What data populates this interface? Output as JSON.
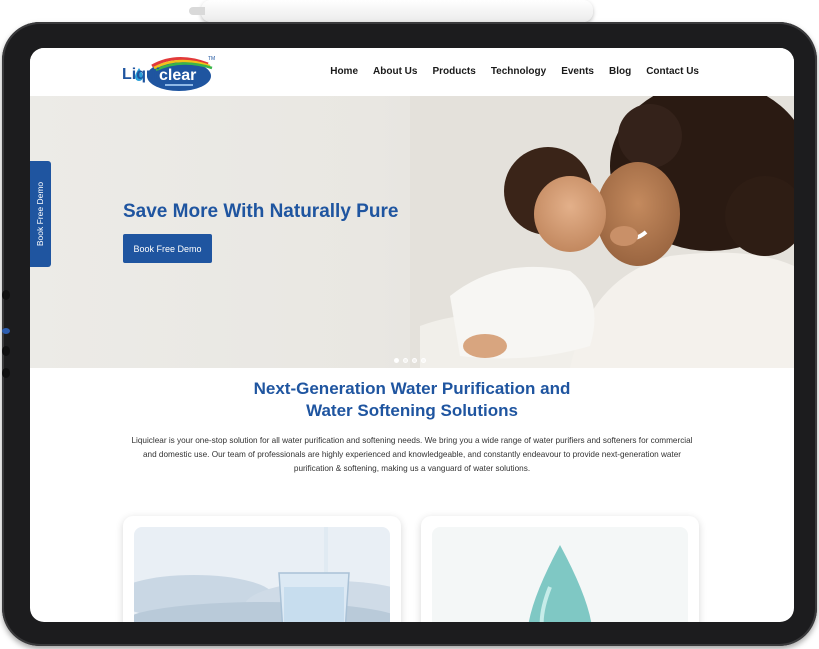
{
  "brand": {
    "name_part1": "Liqui",
    "name_part2": "clear",
    "trademark": "TM"
  },
  "nav": {
    "items": [
      {
        "label": "Home"
      },
      {
        "label": "About Us"
      },
      {
        "label": "Products"
      },
      {
        "label": "Technology"
      },
      {
        "label": "Events"
      },
      {
        "label": "Blog"
      },
      {
        "label": "Contact Us"
      }
    ]
  },
  "side_tab": {
    "label": "Book Free Demo"
  },
  "hero": {
    "title": "Save More With Naturally Pure",
    "button_label": "Book Free Demo",
    "slides": {
      "count": 4,
      "active_index": 0
    }
  },
  "intro": {
    "title_line1": "Next-Generation Water Purification and",
    "title_line2": "Water Softening Solutions",
    "paragraph": "Liquiclear is your one-stop solution for all water purification and softening needs. We bring you a wide range of water purifiers and softeners for commercial and domestic use. Our team of professionals are highly experienced and knowledgeable, and constantly endeavour to provide next-generation water purification & softening, making us a vanguard of water solutions."
  },
  "cards": [
    {
      "image": "water-glass-pour"
    },
    {
      "image": "water-drop"
    }
  ],
  "colors": {
    "brand_blue": "#1f55a0",
    "frame": "#1c1c1e",
    "text_dark": "#1a1a1a"
  }
}
